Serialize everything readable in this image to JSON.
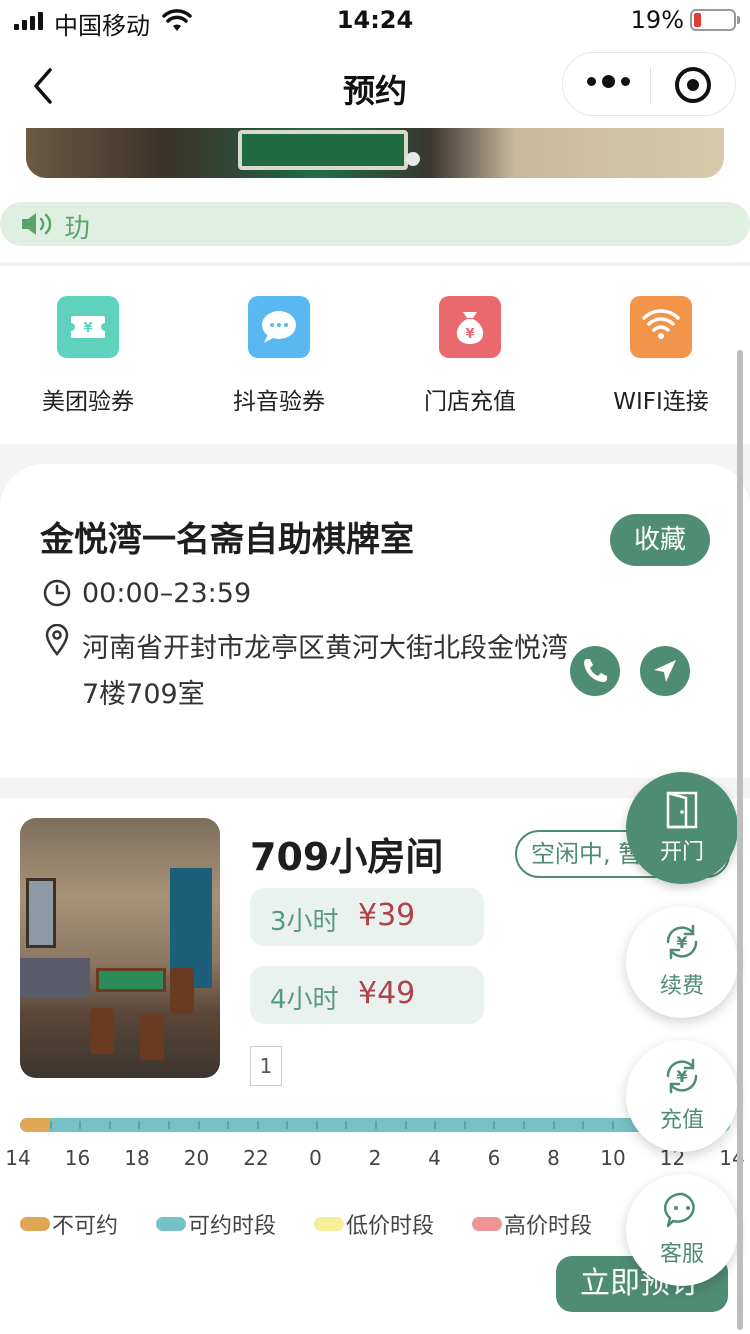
{
  "status_bar": {
    "carrier": "中国移动",
    "time": "14:24",
    "battery": "19%",
    "battery_level": 0.19
  },
  "nav": {
    "title": "预约"
  },
  "notice": {
    "text": "玏"
  },
  "quick_actions": [
    {
      "label": "美团验券",
      "icon": "meituan-voucher-icon",
      "color": "#5fd2bd"
    },
    {
      "label": "抖音验券",
      "icon": "douyin-chat-icon",
      "color": "#59b8ef"
    },
    {
      "label": "门店充值",
      "icon": "money-bag-icon",
      "color": "#e9696e"
    },
    {
      "label": "WIFI连接",
      "icon": "wifi-icon",
      "color": "#f2944a"
    }
  ],
  "store": {
    "name": "金悦湾一名斋自助棋牌室",
    "favorite_label": "收藏",
    "hours": "00:00–23:59",
    "address": "河南省开封市龙亭区黄河大街北段金悦湾7楼709室"
  },
  "room": {
    "name": "709小房间",
    "status": "空闲中, 暂",
    "prices": [
      {
        "hours": "3小时",
        "amount": "¥39"
      },
      {
        "hours": "4小时",
        "amount": "¥49"
      }
    ],
    "page": "1",
    "timeline_labels": [
      "14",
      "16",
      "18",
      "20",
      "22",
      "0",
      "2",
      "4",
      "6",
      "8",
      "10",
      "12",
      "14"
    ],
    "blocked_fraction": 0.042,
    "legend": [
      {
        "label": "不可约",
        "color": "#e0a555"
      },
      {
        "label": "可约时段",
        "color": "#76c1c6"
      },
      {
        "label": "低价时段",
        "color": "#f5ef9a"
      },
      {
        "label": "高价时段",
        "color": "#ee9494"
      }
    ],
    "book_label": "立即预订"
  },
  "floating": {
    "open_door": "开门",
    "renew": "续费",
    "recharge": "充值",
    "service": "客服"
  },
  "colors": {
    "primary": "#4f8c74",
    "price": "#b0424a"
  }
}
